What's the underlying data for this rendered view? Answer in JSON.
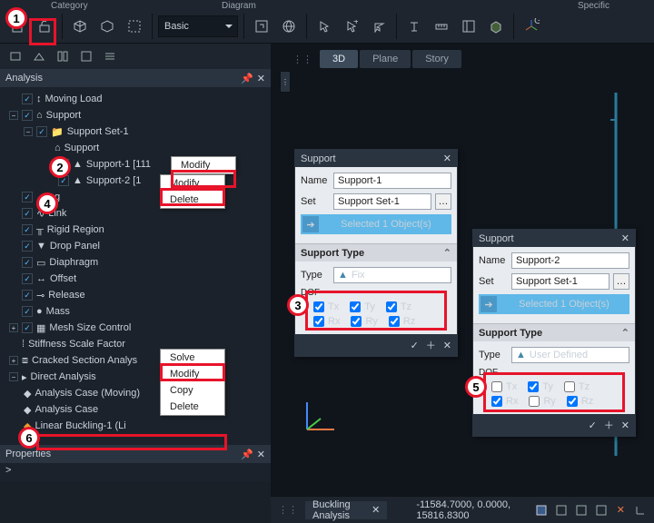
{
  "header": {
    "words": [
      "Category",
      "Diagram",
      "Specific"
    ]
  },
  "toolbar": {
    "basic": "Basic"
  },
  "viewTabs": {
    "t3d": "3D",
    "plane": "Plane",
    "story": "Story"
  },
  "analysisPanel": {
    "title": "Analysis",
    "tree": {
      "movingLoad": "Moving Load",
      "support": "Support",
      "supportSet1": "Support Set-1",
      "supportNode": "Support",
      "support1": "Support-1 [111",
      "support2": "Support-2 [1",
      "link": "Link",
      "rigidRegion": "Rigid Region",
      "dropPanel": "Drop Panel",
      "diaphragm": "Diaphragm",
      "offset": "Offset",
      "release": "Release",
      "mass": "Mass",
      "meshSize": "Mesh Size Control",
      "stiffness": "Stiffness Scale Factor",
      "cracked": "Cracked Section Analys",
      "direct": "Direct Analysis",
      "caseMoving": "Analysis Case (Moving)",
      "case": "Analysis Case",
      "linearBuckling": "Linear Buckling-1 (Li"
    },
    "hiddenItem": "g"
  },
  "ctxMenus": {
    "m1": {
      "modify": "Modify"
    },
    "m2": {
      "modify": "Modify",
      "delete": "Delete"
    },
    "m3": {
      "solve": "Solve",
      "modify": "Modify",
      "copy": "Copy",
      "delete": "Delete"
    }
  },
  "propertiesPanel": {
    "title": "Properties",
    "prompt": ">"
  },
  "dlgSupport1": {
    "title": "Support",
    "nameLbl": "Name",
    "name": "Support-1",
    "setLbl": "Set",
    "set": "Support Set-1",
    "selected": "Selected 1 Object(s)",
    "supportType": "Support Type",
    "typeLbl": "Type",
    "type": "Fix",
    "dofLbl": "DOF",
    "dof": {
      "tx": "Tx",
      "ty": "Ty",
      "tz": "Tz",
      "rx": "Rx",
      "ry": "Ry",
      "rz": "Rz"
    }
  },
  "dlgSupport2": {
    "title": "Support",
    "nameLbl": "Name",
    "name": "Support-2",
    "setLbl": "Set",
    "set": "Support Set-1",
    "selected": "Selected 1 Object(s)",
    "supportType": "Support Type",
    "typeLbl": "Type",
    "type": "User Defined",
    "dofLbl": "DOF",
    "dof": {
      "tx": "Tx",
      "ty": "Ty",
      "tz": "Tz",
      "rx": "Rx",
      "ry": "Ry",
      "rz": "Rz"
    }
  },
  "status": {
    "tab": "Buckling Analysis",
    "coord": "-11584.7000, 0.0000, 15816.8300"
  },
  "annotations": {
    "a1": "1",
    "a2": "2",
    "a3": "3",
    "a4": "4",
    "a5": "5",
    "a6": "6"
  }
}
